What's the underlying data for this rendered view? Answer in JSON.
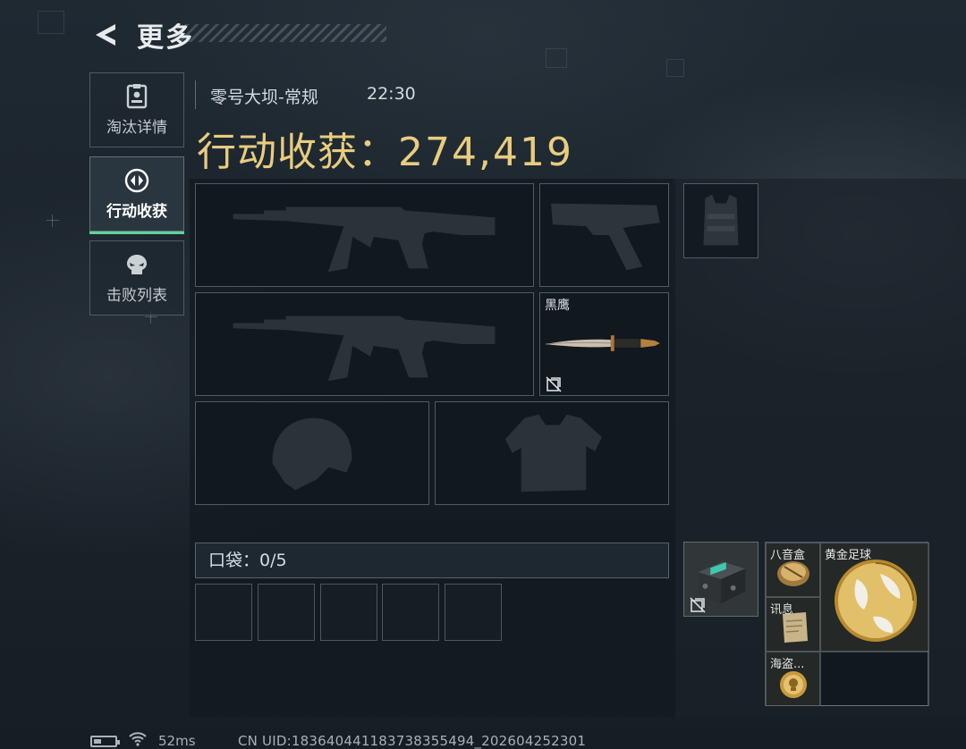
{
  "header": {
    "title": "更多",
    "back_icon": "back-chevron-icon"
  },
  "sidebar": {
    "tabs": [
      {
        "label": "淘汰详情",
        "icon": "id-card-icon",
        "active": false
      },
      {
        "label": "行动收获",
        "icon": "loot-icon",
        "active": true
      },
      {
        "label": "击败列表",
        "icon": "skull-icon",
        "active": false
      }
    ]
  },
  "match": {
    "map": "零号大坝-常规",
    "time": "22:30",
    "harvest_label": "行动收获：",
    "harvest_value": "274,419"
  },
  "equipment": {
    "primary_weapon_1": {
      "icon": "assault-rifle-icon",
      "filled": false
    },
    "pistol": {
      "icon": "pistol-icon",
      "filled": false
    },
    "primary_weapon_2": {
      "icon": "assault-rifle-icon",
      "filled": false
    },
    "melee": {
      "name": "黑鹰",
      "icon": "knife-icon",
      "filled": true,
      "badge": "unbound-icon"
    },
    "helmet": {
      "icon": "helmet-icon",
      "filled": false
    },
    "armor": {
      "icon": "body-armor-icon",
      "filled": false
    },
    "chest_rig": {
      "icon": "chest-rig-icon",
      "filled": false
    }
  },
  "pocket": {
    "label": "口袋：",
    "count": "0/5",
    "slots": 5
  },
  "backpack": {
    "item": {
      "icon": "backpack-case-icon",
      "badge": "unbound-icon"
    }
  },
  "loot": [
    {
      "name": "八音盒",
      "icon": "music-box-icon"
    },
    {
      "name": "讯息",
      "icon": "parchment-icon"
    },
    {
      "name": "海盗...",
      "icon": "pirate-coin-icon"
    },
    {
      "name": "黄金足球",
      "icon": "golden-football-icon"
    }
  ],
  "status_bar": {
    "ping": "52ms",
    "uid": "CN UID:183640441183738355494_202604252301",
    "battery_icon": "battery-icon",
    "wifi_icon": "wifi-icon"
  },
  "colors": {
    "accent_green": "#5fd49a",
    "harvest_gold": "#e9cc7e"
  }
}
